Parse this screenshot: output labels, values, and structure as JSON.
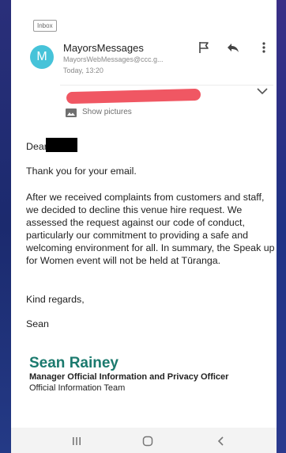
{
  "header": {
    "inbox_tag": "Inbox",
    "avatar_letter": "M",
    "sender_name": "MayorsMessages",
    "sender_address": "MayorsWebMessages@ccc.g...",
    "time": "Today, 13:20",
    "show_pictures": "Show pictures"
  },
  "body": {
    "greeting": "Dear",
    "thanks": "Thank you for your email.",
    "paragraph": "After we received complaints from customers and staff, we decided to decline this venue hire request. We assessed the request against our code of conduct, particularly our commitment to providing a safe and welcoming environment for all. In summary, the Speak up for Women event will not be held at Tūranga.",
    "regards": "Kind regards,",
    "signoff": "Sean"
  },
  "signature": {
    "name": "Sean Rainey",
    "title": "Manager Official Information and Privacy Officer",
    "team": "Official Information Team"
  },
  "colors": {
    "avatar": "#46c3d9",
    "signature_name": "#1b7a6e",
    "redaction_red": "#f05763",
    "background": "#1d2a6e"
  },
  "icons": [
    "flag-icon",
    "reply-icon",
    "more-vert-icon",
    "chevron-down-icon",
    "image-icon",
    "recent-apps-icon",
    "home-icon",
    "back-icon"
  ]
}
